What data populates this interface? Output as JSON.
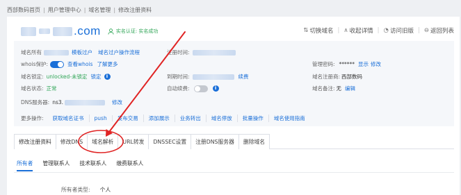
{
  "breadcrumb": [
    "西部数码首页",
    "用户管理中心",
    "域名管理",
    "修改注册资料"
  ],
  "domain": {
    "suffix": ".com",
    "verify_text": "实名认证: 实名成功"
  },
  "tools": [
    {
      "icon": "switch-icon",
      "label": "切换域名"
    },
    {
      "icon": "collapse-icon",
      "label": "收起详情"
    },
    {
      "icon": "history-icon",
      "label": "访问旧版"
    },
    {
      "icon": "back-icon",
      "label": "返回列表"
    }
  ],
  "info": {
    "owner_label": "域名所有",
    "owner_link1": "模板过户",
    "owner_link2": "域名过户操作流程",
    "whois_label": "whois保护:",
    "whois_link1": "查看whois",
    "whois_link2": "了解更多",
    "lock_label": "域名锁定:",
    "lock_value": "unlocked-未锁定",
    "lock_link": "锁定",
    "status_label": "域名状态:",
    "status_value": "正常",
    "regtime_label": "注册时间:",
    "expire_label": "到期时间:",
    "expire_link": "续费",
    "autorenew_label": "自动续费:",
    "pwd_label": "管理密码:",
    "pwd_value": "******",
    "pwd_show": "显示",
    "pwd_edit": "修改",
    "registrar_label": "域名注册商:",
    "registrar_value": "西部数码",
    "note_label": "域名备注:",
    "note_value": "无",
    "note_edit": "编辑",
    "dns_label": "DNS服务器:",
    "dns_value": "ns3.",
    "dns_edit": "修改",
    "whois_on": true,
    "autorenew_on": false
  },
  "more": {
    "label": "更多操作:",
    "ops": [
      "获取域名证书",
      "push",
      "发布交易",
      "添加展示",
      "业务转出",
      "域名停放",
      "批量操作",
      "域名使用指南"
    ]
  },
  "tabs": [
    "修改注册资料",
    "修改DNS",
    "域名解析",
    "URL转发",
    "DNSSEC设置",
    "注册DNS服务器",
    "删除域名"
  ],
  "subtabs": [
    "所有者",
    "管理联系人",
    "技术联系人",
    "缴费联系人"
  ],
  "owner": {
    "type_label": "所有者类型:",
    "type_value": "个人"
  },
  "colors": {
    "accent": "#1a6fd8",
    "annotation": "#e02424",
    "ok": "#2fa556"
  }
}
